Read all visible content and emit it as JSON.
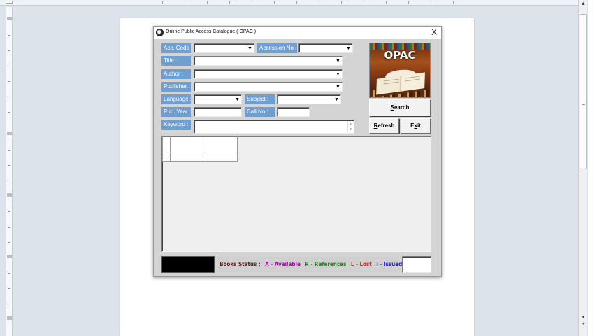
{
  "window": {
    "title": "Online Public Access Catalogue ( OPAC )",
    "close_glyph": "X"
  },
  "form": {
    "acc_code_label": "Acc. Code :",
    "accession_no_label": "Accession No :",
    "title_label": "Title :",
    "author_label": "Author :",
    "publisher_label": "Publisher :",
    "language_label": "Language :",
    "subject_label": "Subject :",
    "pub_year_label": "Pub. Year :",
    "call_no_label": "Call No :",
    "keyword_label": "Keyword :"
  },
  "logo": {
    "text": "OPAC"
  },
  "buttons": {
    "search": "Search",
    "search_mnemonic": "S",
    "refresh": "Refresh",
    "refresh_mnemonic": "R",
    "exit": "Exit",
    "exit_mnemonic": "x"
  },
  "status": {
    "prefix": "Books Status :",
    "legend": [
      {
        "text": "A - Available",
        "color": "#b000b0"
      },
      {
        "text": "R - References",
        "color": "#138a13"
      },
      {
        "text": "L - Lost",
        "color": "#e0201e"
      },
      {
        "text": "I - Issued",
        "color": "#2020d0"
      }
    ]
  },
  "icons": {
    "dropdown": "arrow-down-icon",
    "app": "app-icon"
  }
}
